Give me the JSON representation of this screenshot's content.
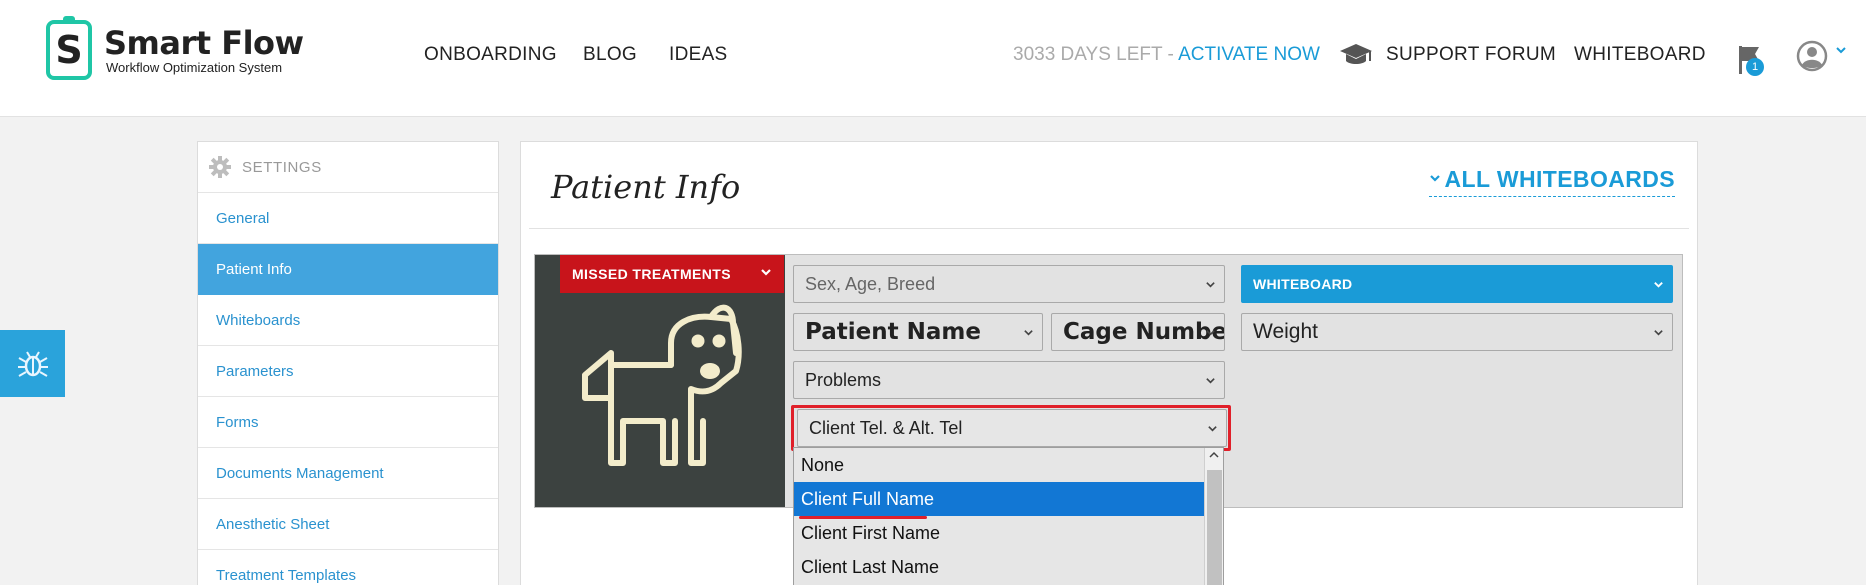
{
  "brand": {
    "name": "Smart Flow",
    "tagline": "Workflow Optimization System",
    "letter": "S",
    "accent": "#1fc6a6"
  },
  "nav": {
    "onboarding": "ONBOARDING",
    "blog": "BLOG",
    "ideas": "IDEAS"
  },
  "trial": {
    "days_left": "3033 DAYS LEFT - ",
    "activate": "ACTIVATE NOW"
  },
  "header_right": {
    "support_forum": "SUPPORT FORUM",
    "whiteboard": "WHITEBOARD",
    "notification_count": "1"
  },
  "sidebar": {
    "heading": "SETTINGS",
    "items": [
      {
        "label": "General",
        "active": false
      },
      {
        "label": "Patient Info",
        "active": true
      },
      {
        "label": "Whiteboards",
        "active": false
      },
      {
        "label": "Parameters",
        "active": false
      },
      {
        "label": "Forms",
        "active": false
      },
      {
        "label": "Documents Management",
        "active": false
      },
      {
        "label": "Anesthetic Sheet",
        "active": false
      },
      {
        "label": "Treatment Templates",
        "active": false
      }
    ]
  },
  "main": {
    "title": "Patient Info",
    "all_whiteboards": "ALL WHITEBOARDS",
    "missed_treatments": "MISSED TREATMENTS",
    "fields": {
      "sex_age_breed": "Sex, Age, Breed",
      "patient_name": "Patient Name",
      "cage_number": "Cage Numbe",
      "problems": "Problems",
      "client_tel": "Client Tel. & Alt. Tel",
      "whiteboard": "WHITEBOARD",
      "weight": "Weight"
    },
    "dropdown_options": [
      "None",
      "Client Full Name",
      "Client First Name",
      "Client Last Name"
    ],
    "dropdown_selected": "Client Full Name"
  },
  "colors": {
    "primary": "#1a9bd7",
    "danger": "#c8141b",
    "card_bg": "#3c4240",
    "dog_stroke": "#f3eccb"
  }
}
